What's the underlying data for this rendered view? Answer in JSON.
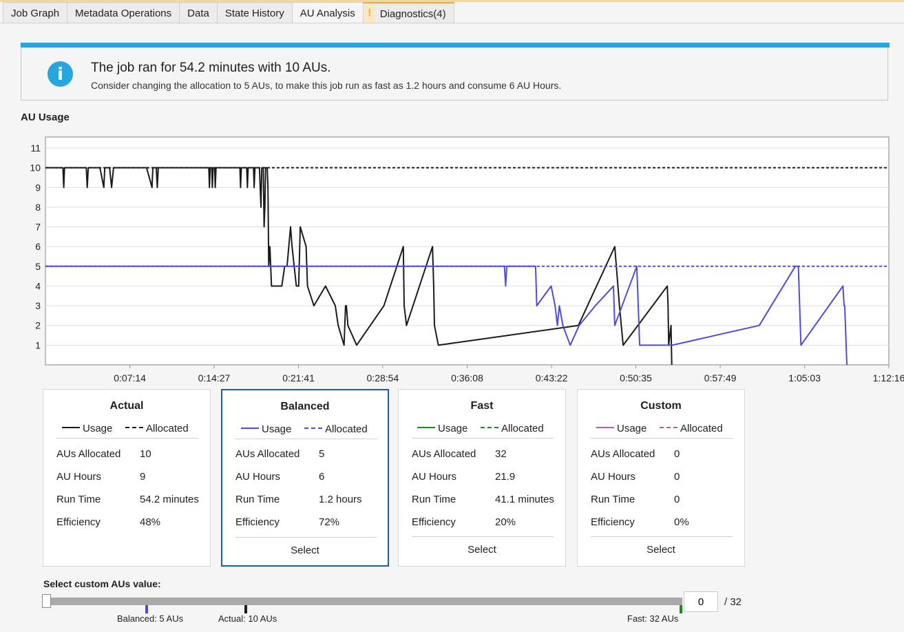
{
  "tabs": [
    {
      "label": "Job Graph",
      "active": false
    },
    {
      "label": "Metadata Operations",
      "active": false
    },
    {
      "label": "Data",
      "active": false
    },
    {
      "label": "State History",
      "active": false
    },
    {
      "label": "AU Analysis",
      "active": true
    },
    {
      "label": "Diagnostics(4)",
      "active": false,
      "icon": "warning-icon"
    }
  ],
  "banner": {
    "icon": "info-icon",
    "icon_glyph": "i",
    "warn_glyph": "!",
    "title": "The job ran for 54.2 minutes with 10 AUs.",
    "subtitle": "Consider changing the allocation to 5 AUs, to make this job run as fast as 1.2 hours and consume 6 AU Hours."
  },
  "chart_title": "AU Usage",
  "chart_data": {
    "type": "line",
    "x_unit": "seconds",
    "xlim": [
      0,
      4336
    ],
    "ylim": [
      0,
      11
    ],
    "y_ticks": [
      1,
      2,
      3,
      4,
      5,
      6,
      7,
      8,
      9,
      10,
      11
    ],
    "x_ticks": [
      {
        "t": 434,
        "label": "0:07:14"
      },
      {
        "t": 867,
        "label": "0:14:27"
      },
      {
        "t": 1301,
        "label": "0:21:41"
      },
      {
        "t": 1734,
        "label": "0:28:54"
      },
      {
        "t": 2168,
        "label": "0:36:08"
      },
      {
        "t": 2602,
        "label": "0:43:22"
      },
      {
        "t": 3035,
        "label": "0:50:35"
      },
      {
        "t": 3469,
        "label": "0:57:49"
      },
      {
        "t": 3903,
        "label": "1:05:03"
      },
      {
        "t": 4336,
        "label": "1:12:16"
      }
    ],
    "grid": true,
    "series": [
      {
        "name": "Actual Usage",
        "color": "#1a1a1a",
        "dash": false,
        "points": [
          [
            0,
            10
          ],
          [
            90,
            10
          ],
          [
            94,
            9
          ],
          [
            98,
            10
          ],
          [
            190,
            10
          ],
          [
            210,
            10
          ],
          [
            215,
            9
          ],
          [
            220,
            10
          ],
          [
            280,
            10
          ],
          [
            300,
            9
          ],
          [
            305,
            10
          ],
          [
            330,
            10
          ],
          [
            340,
            9
          ],
          [
            350,
            10
          ],
          [
            520,
            10
          ],
          [
            548,
            9
          ],
          [
            552,
            10
          ],
          [
            570,
            10
          ],
          [
            575,
            9
          ],
          [
            580,
            10
          ],
          [
            840,
            10
          ],
          [
            843,
            9
          ],
          [
            847,
            10
          ],
          [
            855,
            10
          ],
          [
            858,
            9
          ],
          [
            862,
            10
          ],
          [
            870,
            10
          ],
          [
            873,
            9
          ],
          [
            877,
            10
          ],
          [
            1000,
            10
          ],
          [
            1003,
            9
          ],
          [
            1007,
            10
          ],
          [
            1035,
            10
          ],
          [
            1038,
            9
          ],
          [
            1042,
            10
          ],
          [
            1070,
            10
          ],
          [
            1073,
            9
          ],
          [
            1077,
            10
          ],
          [
            1100,
            10
          ],
          [
            1104,
            9
          ],
          [
            1108,
            8
          ],
          [
            1112,
            10
          ],
          [
            1120,
            10
          ],
          [
            1124,
            7
          ],
          [
            1128,
            8
          ],
          [
            1132,
            10
          ],
          [
            1140,
            10
          ],
          [
            1144,
            9
          ],
          [
            1148,
            5
          ],
          [
            1154,
            6
          ],
          [
            1162,
            4
          ],
          [
            1215,
            4
          ],
          [
            1230,
            5
          ],
          [
            1242,
            5
          ],
          [
            1260,
            7
          ],
          [
            1268,
            6
          ],
          [
            1290,
            4
          ],
          [
            1302,
            4
          ],
          [
            1310,
            7
          ],
          [
            1340,
            6
          ],
          [
            1347,
            4
          ],
          [
            1380,
            3
          ],
          [
            1440,
            4
          ],
          [
            1490,
            3
          ],
          [
            1505,
            2
          ],
          [
            1535,
            1
          ],
          [
            1543,
            3
          ],
          [
            1547,
            3
          ],
          [
            1555,
            2
          ],
          [
            1600,
            1
          ],
          [
            1740,
            3
          ],
          [
            1840,
            6
          ],
          [
            1844,
            3
          ],
          [
            1856,
            2
          ],
          [
            1990,
            6
          ],
          [
            1996,
            4
          ],
          [
            2000,
            2
          ],
          [
            2020,
            1
          ],
          [
            2740,
            2
          ],
          [
            2927,
            6
          ],
          [
            2943,
            4
          ],
          [
            2951,
            3
          ],
          [
            2970,
            1
          ],
          [
            3197,
            4
          ],
          [
            3201,
            3
          ],
          [
            3204,
            1
          ],
          [
            3216,
            2
          ],
          [
            3220,
            0
          ]
        ]
      },
      {
        "name": "Actual Allocated",
        "color": "#1a1a1a",
        "dash": true,
        "points": [
          [
            0,
            10
          ],
          [
            4336,
            10
          ]
        ]
      },
      {
        "name": "Balanced Usage",
        "color": "#4b4bde",
        "dash": false,
        "points": [
          [
            0,
            5
          ],
          [
            2360,
            5
          ],
          [
            2366,
            4
          ],
          [
            2372,
            5
          ],
          [
            2520,
            5
          ],
          [
            2526,
            3
          ],
          [
            2600,
            4
          ],
          [
            2620,
            3
          ],
          [
            2632,
            2
          ],
          [
            2642,
            3
          ],
          [
            2660,
            2
          ],
          [
            2698,
            1
          ],
          [
            2744,
            2
          ],
          [
            2827,
            3
          ],
          [
            2920,
            4
          ],
          [
            2927,
            2
          ],
          [
            3040,
            5
          ],
          [
            3055,
            1
          ],
          [
            3224,
            1
          ],
          [
            3222,
            1
          ],
          [
            3670,
            2
          ],
          [
            3855,
            5
          ],
          [
            3871,
            5
          ],
          [
            3884,
            1
          ],
          [
            4100,
            4
          ],
          [
            4106,
            3
          ],
          [
            4109,
            3
          ],
          [
            4120,
            0
          ]
        ]
      },
      {
        "name": "Balanced Allocated",
        "color": "#4b4bde",
        "dash": true,
        "points": [
          [
            0,
            5
          ],
          [
            4336,
            5
          ]
        ]
      }
    ]
  },
  "cards": [
    {
      "title": "Actual",
      "selected": false,
      "legend_usage": "Usage",
      "legend_allocated": "Allocated",
      "color": "#1a1a1a",
      "rows": [
        {
          "key": "AUs Allocated",
          "value": "10"
        },
        {
          "key": "AU Hours",
          "value": "9"
        },
        {
          "key": "Run Time",
          "value": "54.2 minutes"
        },
        {
          "key": "Efficiency",
          "value": "48%"
        }
      ],
      "select_label": ""
    },
    {
      "title": "Balanced",
      "selected": true,
      "legend_usage": "Usage",
      "legend_allocated": "Allocated",
      "color": "#4b4bde",
      "rows": [
        {
          "key": "AUs Allocated",
          "value": "5"
        },
        {
          "key": "AU Hours",
          "value": "6"
        },
        {
          "key": "Run Time",
          "value": "1.2 hours"
        },
        {
          "key": "Efficiency",
          "value": "72%"
        }
      ],
      "select_label": "Select"
    },
    {
      "title": "Fast",
      "selected": false,
      "legend_usage": "Usage",
      "legend_allocated": "Allocated",
      "color": "#1a8a1a",
      "rows": [
        {
          "key": "AUs Allocated",
          "value": "32"
        },
        {
          "key": "AU Hours",
          "value": "21.9"
        },
        {
          "key": "Run Time",
          "value": "41.1 minutes"
        },
        {
          "key": "Efficiency",
          "value": "20%"
        }
      ],
      "select_label": "Select"
    },
    {
      "title": "Custom",
      "selected": false,
      "legend_usage": "Usage",
      "legend_allocated": "Allocated",
      "color": "#b35cb3",
      "rows": [
        {
          "key": "AUs Allocated",
          "value": "0"
        },
        {
          "key": "AU Hours",
          "value": "0"
        },
        {
          "key": "Run Time",
          "value": "0"
        },
        {
          "key": "Efficiency",
          "value": "0%"
        }
      ],
      "select_label": "Select"
    }
  ],
  "slider": {
    "label": "Select custom AUs value:",
    "value": "0",
    "max_label": "/ 32",
    "markers": [
      {
        "label": "Balanced: 5 AUs",
        "color": "#4b4bde"
      },
      {
        "label": "Actual: 10 AUs",
        "color": "#1a1a1a"
      },
      {
        "label": "Fast: 32 AUs",
        "color": "#1a8a1a"
      }
    ]
  }
}
